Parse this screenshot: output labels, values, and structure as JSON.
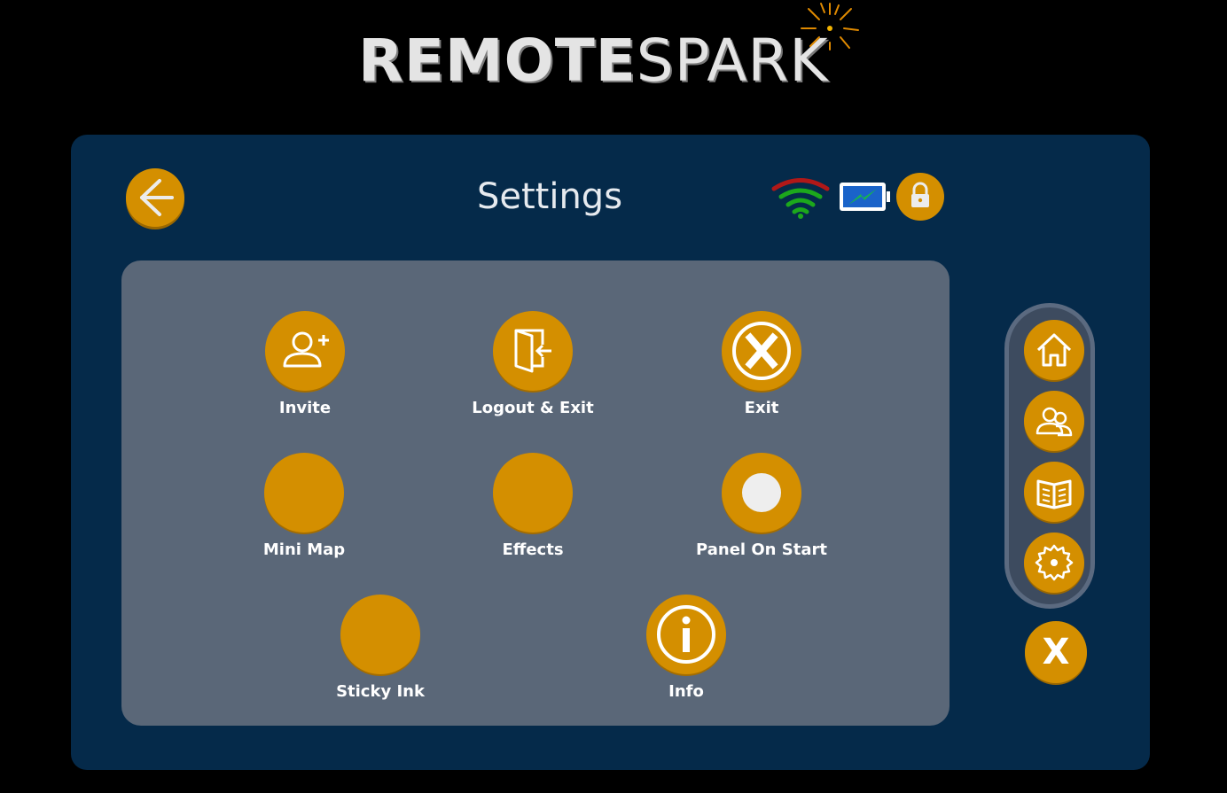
{
  "brand": {
    "bold": "REMOTE",
    "light": "SPARK"
  },
  "header": {
    "title": "Settings"
  },
  "status": {
    "wifi": "wifi-icon",
    "battery": "battery-charging-icon",
    "lock": "lock-icon"
  },
  "colors": {
    "accent": "#d48f00",
    "panel": "#052a4a",
    "content": "#5a6778",
    "rail": "#3d4b5f"
  },
  "settings": {
    "items": [
      {
        "label": "Invite",
        "icon": "add-user-icon"
      },
      {
        "label": "Logout & Exit",
        "icon": "logout-door-icon"
      },
      {
        "label": "Exit",
        "icon": "exit-x-icon"
      },
      {
        "label": "Mini Map",
        "icon": "toggle-off",
        "enabled": false
      },
      {
        "label": "Effects",
        "icon": "toggle-off",
        "enabled": false
      },
      {
        "label": "Panel On Start",
        "icon": "toggle-on",
        "enabled": true
      },
      {
        "label": "Sticky Ink",
        "icon": "toggle-off",
        "enabled": false
      },
      {
        "label": "Info",
        "icon": "info-icon"
      }
    ]
  },
  "rail": {
    "items": [
      {
        "icon": "home-icon"
      },
      {
        "icon": "users-icon"
      },
      {
        "icon": "book-icon"
      },
      {
        "icon": "gear-icon"
      }
    ],
    "close_label": "X"
  }
}
